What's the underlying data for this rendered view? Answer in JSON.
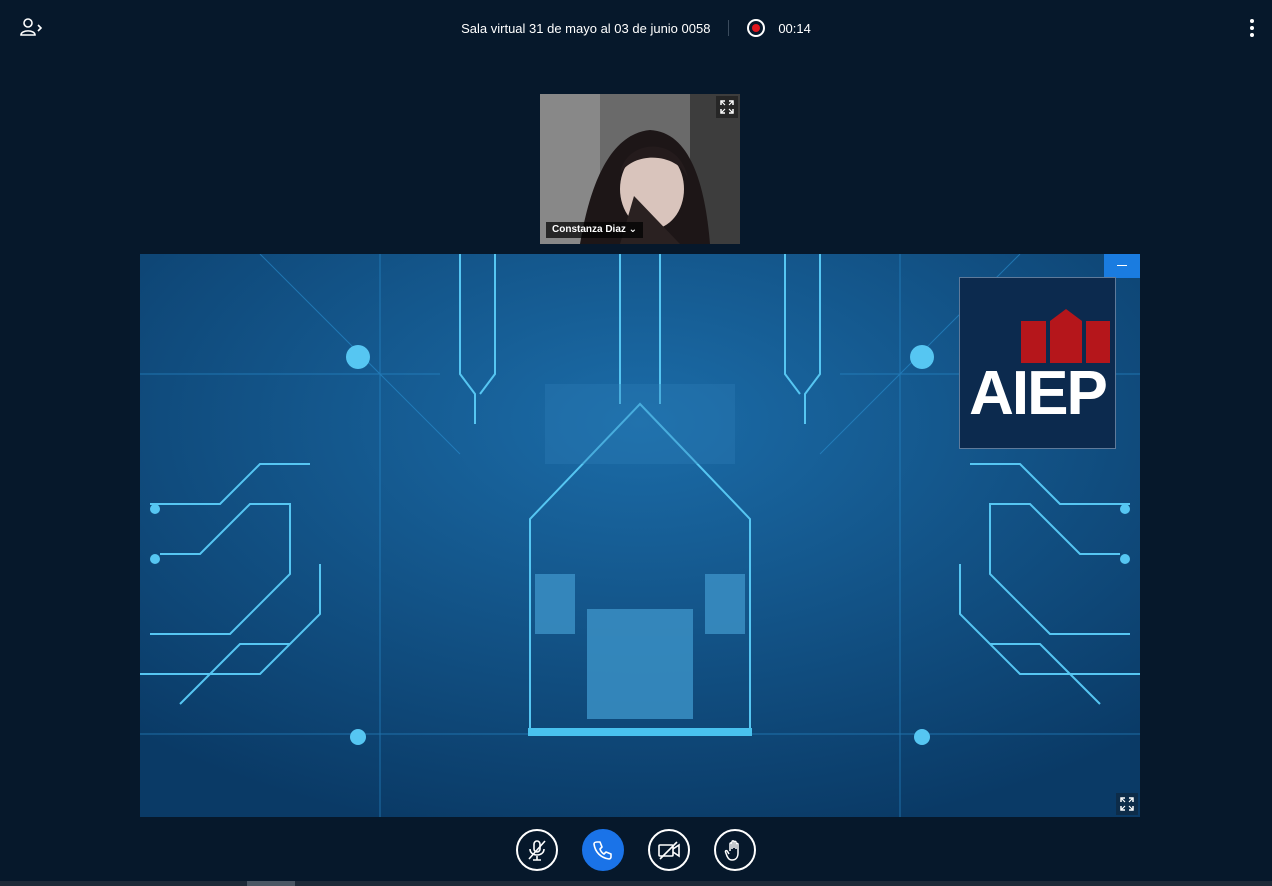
{
  "header": {
    "meeting_title": "Sala virtual 31 de mayo al 03 de junio 0058",
    "recording_time": "00:14",
    "recording_color": "#e0161e"
  },
  "webcam": {
    "participant_name": "Constanza Diaz"
  },
  "presentation": {
    "logo_text": "AIEP",
    "logo_bar_color": "#b5161b",
    "background_color": "#0d4a7b"
  },
  "icons": {
    "users": "users-toggle-icon",
    "more": "more-vertical-icon",
    "record": "record-icon",
    "fullscreen": "fullscreen-icon",
    "minimize": "minimize-icon",
    "mic": "mic-muted-icon",
    "phone": "phone-icon",
    "camera": "camera-off-icon",
    "hand": "raise-hand-icon"
  },
  "colors": {
    "page_bg": "#06182b",
    "accent": "#1a73e8"
  }
}
